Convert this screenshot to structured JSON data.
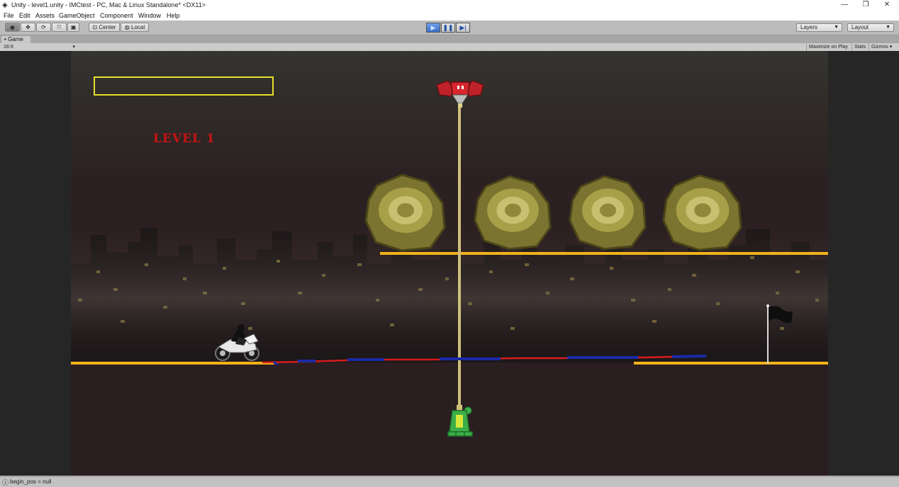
{
  "window": {
    "title": "Unity - level1.unity - IMCtest - PC, Mac & Linux Standalone* <DX11>",
    "controls": [
      "—",
      "❐",
      "✕"
    ]
  },
  "menu": [
    "File",
    "Edit",
    "Assets",
    "GameObject",
    "Component",
    "Window",
    "Help"
  ],
  "toolbar": {
    "pivot_label": "Center",
    "space_label": "Local",
    "layers_label": "Layers",
    "layout_label": "Layout"
  },
  "tab": {
    "label": "Game"
  },
  "gamebar": {
    "aspect": "16:9",
    "maximize_label": "Maximize on Play",
    "stats_label": "Stats",
    "gizmos_label": "Gizmos"
  },
  "game": {
    "level_label": "LEVEL 1",
    "score_box_text": ""
  },
  "status": {
    "message": "begin_pos = null"
  },
  "colors": {
    "platform": "#f2b21a",
    "level_text": "#c81414",
    "hud_box": "#e6e02a",
    "line_red": "#d81c1c",
    "line_blue": "#1a2aa8",
    "play_active": "#3a6fc8"
  },
  "icons": {
    "play": "play-icon",
    "pause": "pause-icon",
    "step": "step-icon"
  }
}
